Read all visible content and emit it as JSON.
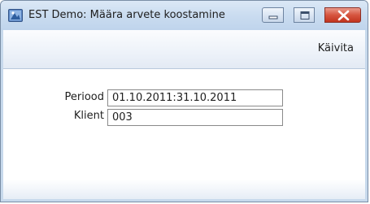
{
  "window": {
    "title": "EST Demo: Määra arvete koostamine",
    "controls": {
      "minimize": "minimize-icon",
      "maximize": "maximize-icon",
      "close": "close-icon"
    }
  },
  "toolbar": {
    "run_label": "Käivita"
  },
  "form": {
    "period_label": "Periood",
    "period_value": "01.10.2011:31.10.2011",
    "client_label": "Klient",
    "client_value": "003"
  },
  "colors": {
    "frame": "#c7d9ec",
    "close_button": "#c2341f",
    "field_border": "#8a8a8a"
  }
}
